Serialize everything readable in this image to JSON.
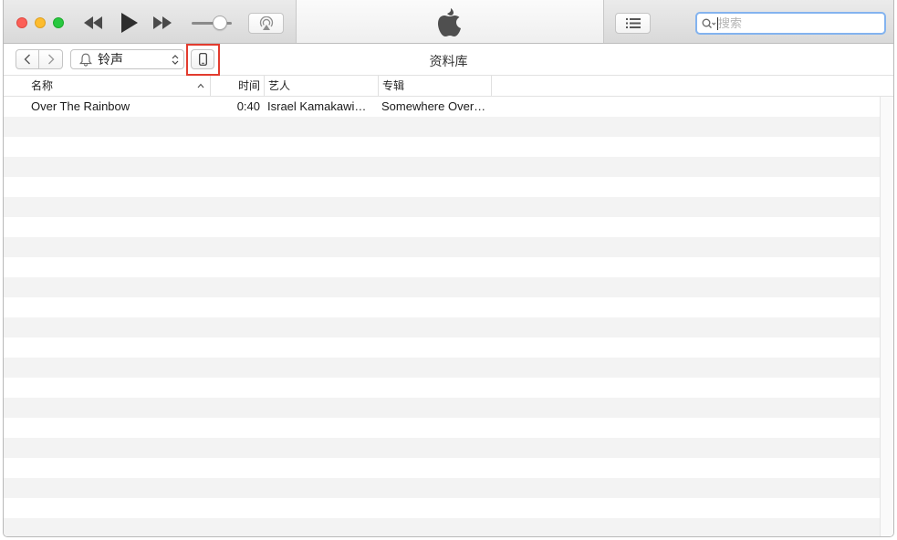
{
  "toolbar": {
    "search_placeholder": "搜索"
  },
  "navbar": {
    "media_type": "铃声",
    "title": "资料库"
  },
  "table": {
    "columns": {
      "name": "名称",
      "time": "时间",
      "artist": "艺人",
      "album": "专辑"
    },
    "rows": [
      {
        "name": "Over The Rainbow",
        "time": "0:40",
        "artist": "Israel Kamakawi…",
        "album": "Somewhere Over…"
      }
    ],
    "empty_rows": 21
  },
  "icons": {
    "close": "close-button",
    "minimize": "minimize-button",
    "zoom": "zoom-button",
    "rewind": "rewind-icon",
    "play": "play-icon",
    "fast_forward": "fast-forward-icon",
    "airplay": "airplay-icon",
    "apple": "apple-logo-icon",
    "list": "list-icon",
    "search": "magnifier-icon",
    "back": "chevron-left-icon",
    "forward": "chevron-right-icon",
    "bell": "bell-icon",
    "device": "iphone-icon",
    "sort": "sort-ascending-icon"
  },
  "colors": {
    "highlight_box": "#e23b2e",
    "search_focus": "#83b3ef",
    "row_stripe": "#f3f3f3"
  }
}
